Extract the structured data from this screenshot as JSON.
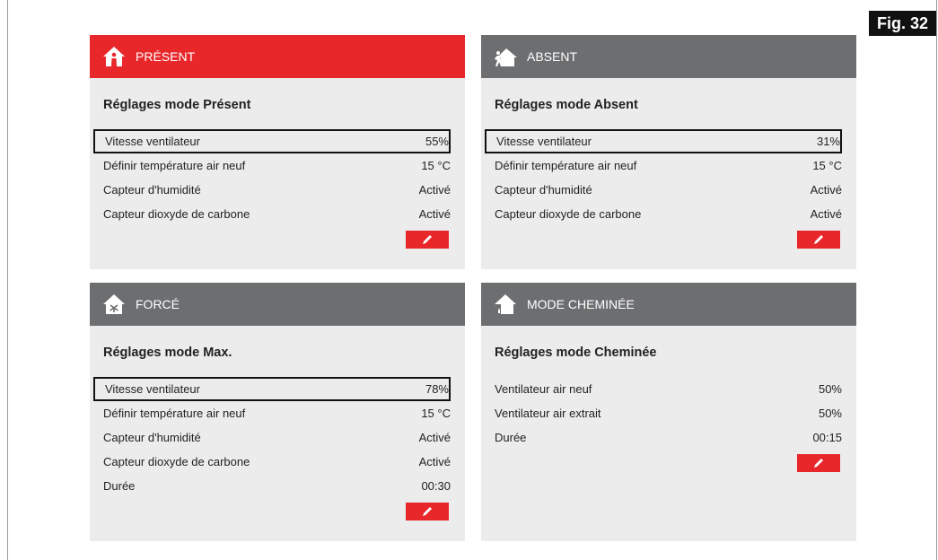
{
  "figure_label": "Fig. 32",
  "cards": {
    "present": {
      "header": "PRÉSENT",
      "icon": "person-house-icon",
      "title": "Réglages mode Présent",
      "rows": [
        {
          "label": "Vitesse ventilateur",
          "value": "55%"
        },
        {
          "label": "Définir température air neuf",
          "value": "15 °C"
        },
        {
          "label": "Capteur d'humidité",
          "value": "Activé"
        },
        {
          "label": "Capteur dioxyde de carbone",
          "value": "Activé"
        }
      ]
    },
    "absent": {
      "header": "ABSENT",
      "icon": "person-leaving-house-icon",
      "title": "Réglages mode Absent",
      "rows": [
        {
          "label": "Vitesse ventilateur",
          "value": "31%"
        },
        {
          "label": "Définir température air neuf",
          "value": "15 °C"
        },
        {
          "label": "Capteur d'humidité",
          "value": "Activé"
        },
        {
          "label": "Capteur dioxyde de carbone",
          "value": "Activé"
        }
      ]
    },
    "force": {
      "header": "FORCÉ",
      "icon": "house-fan-icon",
      "title": "Réglages mode Max.",
      "rows": [
        {
          "label": "Vitesse ventilateur",
          "value": "78%"
        },
        {
          "label": "Définir température air neuf",
          "value": "15 °C"
        },
        {
          "label": "Capteur d'humidité",
          "value": "Activé"
        },
        {
          "label": "Capteur dioxyde de carbone",
          "value": "Activé"
        },
        {
          "label": "Durée",
          "value": "00:30"
        }
      ]
    },
    "cheminee": {
      "header": "MODE CHEMINÉE",
      "icon": "house-fireplace-icon",
      "title": "Réglages mode Cheminée",
      "rows": [
        {
          "label": "Ventilateur air neuf",
          "value": "50%"
        },
        {
          "label": "Ventilateur air extrait",
          "value": "50%"
        },
        {
          "label": "Durée",
          "value": "00:15"
        }
      ]
    }
  },
  "colors": {
    "accent_red": "#e8272b",
    "header_grey": "#6d6e70",
    "card_bg": "#ececec"
  }
}
